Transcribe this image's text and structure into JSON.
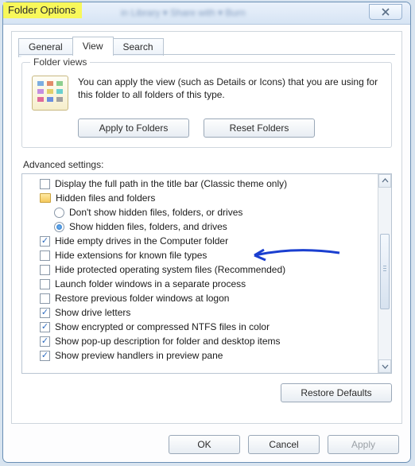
{
  "window": {
    "title": "Folder Options",
    "blur_text": "in Library ▾    Share with ▾    Burn"
  },
  "tabs": {
    "general": "General",
    "view": "View",
    "search": "Search",
    "active": "view"
  },
  "folder_views": {
    "legend": "Folder views",
    "description": "You can apply the view (such as Details or Icons) that you are using for this folder to all folders of this type.",
    "apply_btn": "Apply to Folders",
    "reset_btn": "Reset Folders"
  },
  "advanced": {
    "label": "Advanced settings:",
    "items": [
      {
        "type": "checkbox",
        "checked": false,
        "indent": 1,
        "label": "Display the full path in the title bar (Classic theme only)"
      },
      {
        "type": "folder",
        "indent": 1,
        "label": "Hidden files and folders"
      },
      {
        "type": "radio",
        "checked": false,
        "indent": 2,
        "label": "Don't show hidden files, folders, or drives"
      },
      {
        "type": "radio",
        "checked": true,
        "indent": 2,
        "label": "Show hidden files, folders, and drives"
      },
      {
        "type": "checkbox",
        "checked": true,
        "indent": 1,
        "label": "Hide empty drives in the Computer folder"
      },
      {
        "type": "checkbox",
        "checked": false,
        "indent": 1,
        "label": "Hide extensions for known file types",
        "annotated": true
      },
      {
        "type": "checkbox",
        "checked": false,
        "indent": 1,
        "label": "Hide protected operating system files (Recommended)"
      },
      {
        "type": "checkbox",
        "checked": false,
        "indent": 1,
        "label": "Launch folder windows in a separate process"
      },
      {
        "type": "checkbox",
        "checked": false,
        "indent": 1,
        "label": "Restore previous folder windows at logon"
      },
      {
        "type": "checkbox",
        "checked": true,
        "indent": 1,
        "label": "Show drive letters"
      },
      {
        "type": "checkbox",
        "checked": true,
        "indent": 1,
        "label": "Show encrypted or compressed NTFS files in color"
      },
      {
        "type": "checkbox",
        "checked": true,
        "indent": 1,
        "label": "Show pop-up description for folder and desktop items"
      },
      {
        "type": "checkbox",
        "checked": true,
        "indent": 1,
        "label": "Show preview handlers in preview pane"
      }
    ],
    "restore_btn": "Restore Defaults"
  },
  "footer": {
    "ok": "OK",
    "cancel": "Cancel",
    "apply": "Apply",
    "apply_enabled": false
  },
  "colors": {
    "highlight": "#f8f85a",
    "annotation": "#1a3fd0"
  }
}
